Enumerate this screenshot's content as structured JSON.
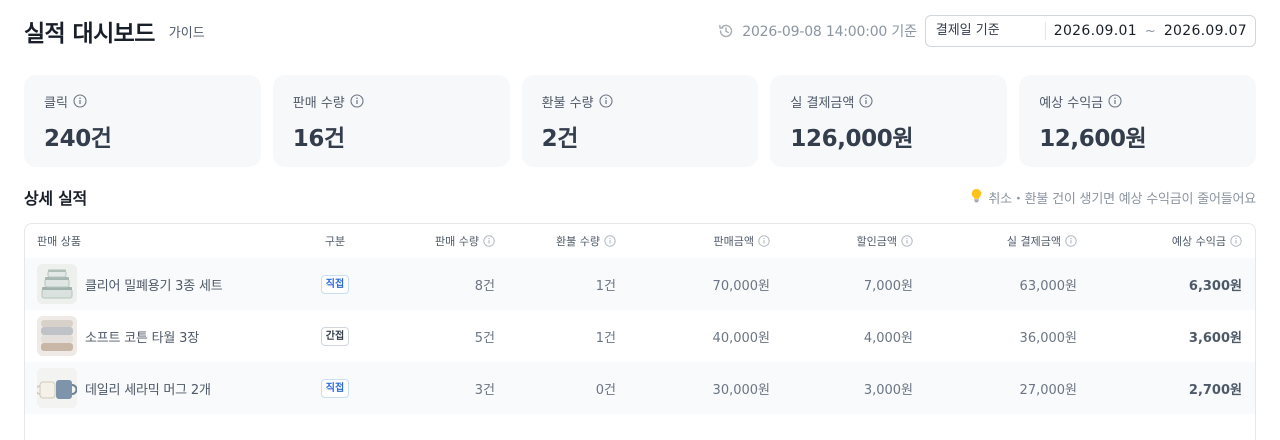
{
  "header": {
    "title": "실적 대시보드",
    "guide_label": "가이드",
    "updated_at": "2026-09-08 14:00:00 기준",
    "date_type": "결제일 기준",
    "date_start": "2026.09.01",
    "date_sep": "~",
    "date_end": "2026.09.07"
  },
  "summary_cards": [
    {
      "label": "클릭",
      "value": "240건"
    },
    {
      "label": "판매 수량",
      "value": "16건"
    },
    {
      "label": "환불 수량",
      "value": "2건"
    },
    {
      "label": "실 결제금액",
      "value": "126,000원"
    },
    {
      "label": "예상 수익금",
      "value": "12,600원"
    }
  ],
  "detail": {
    "title": "상세 실적",
    "tip": "취소・환불 건이 생기면 예상 수익금이 줄어들어요"
  },
  "table": {
    "columns": {
      "product": "판매 상품",
      "type": "구분",
      "qty": "판매 수량",
      "refund": "환불 수량",
      "amount": "판매금액",
      "discount": "할인금액",
      "net": "실 결제금액",
      "revenue": "예상 수익금"
    },
    "rows": [
      {
        "product": "클리어 밀폐용기 3종 세트",
        "type": "직접",
        "qty": "8건",
        "refund": "1건",
        "amount": "70,000원",
        "discount": "7,000원",
        "net": "63,000원",
        "revenue": "6,300원"
      },
      {
        "product": "소프트 코튼 타월 3장",
        "type": "간접",
        "qty": "5건",
        "refund": "1건",
        "amount": "40,000원",
        "discount": "4,000원",
        "net": "36,000원",
        "revenue": "3,600원"
      },
      {
        "product": "데일리 세라믹 머그 2개",
        "type": "직접",
        "qty": "3건",
        "refund": "0건",
        "amount": "30,000원",
        "discount": "3,000원",
        "net": "27,000원",
        "revenue": "2,700원"
      }
    ]
  },
  "colors": {
    "direct_badge": "#2b6cd8",
    "card_bg": "#f7f8fa",
    "text_primary": "#191f28",
    "text_muted": "#8b95a1"
  }
}
